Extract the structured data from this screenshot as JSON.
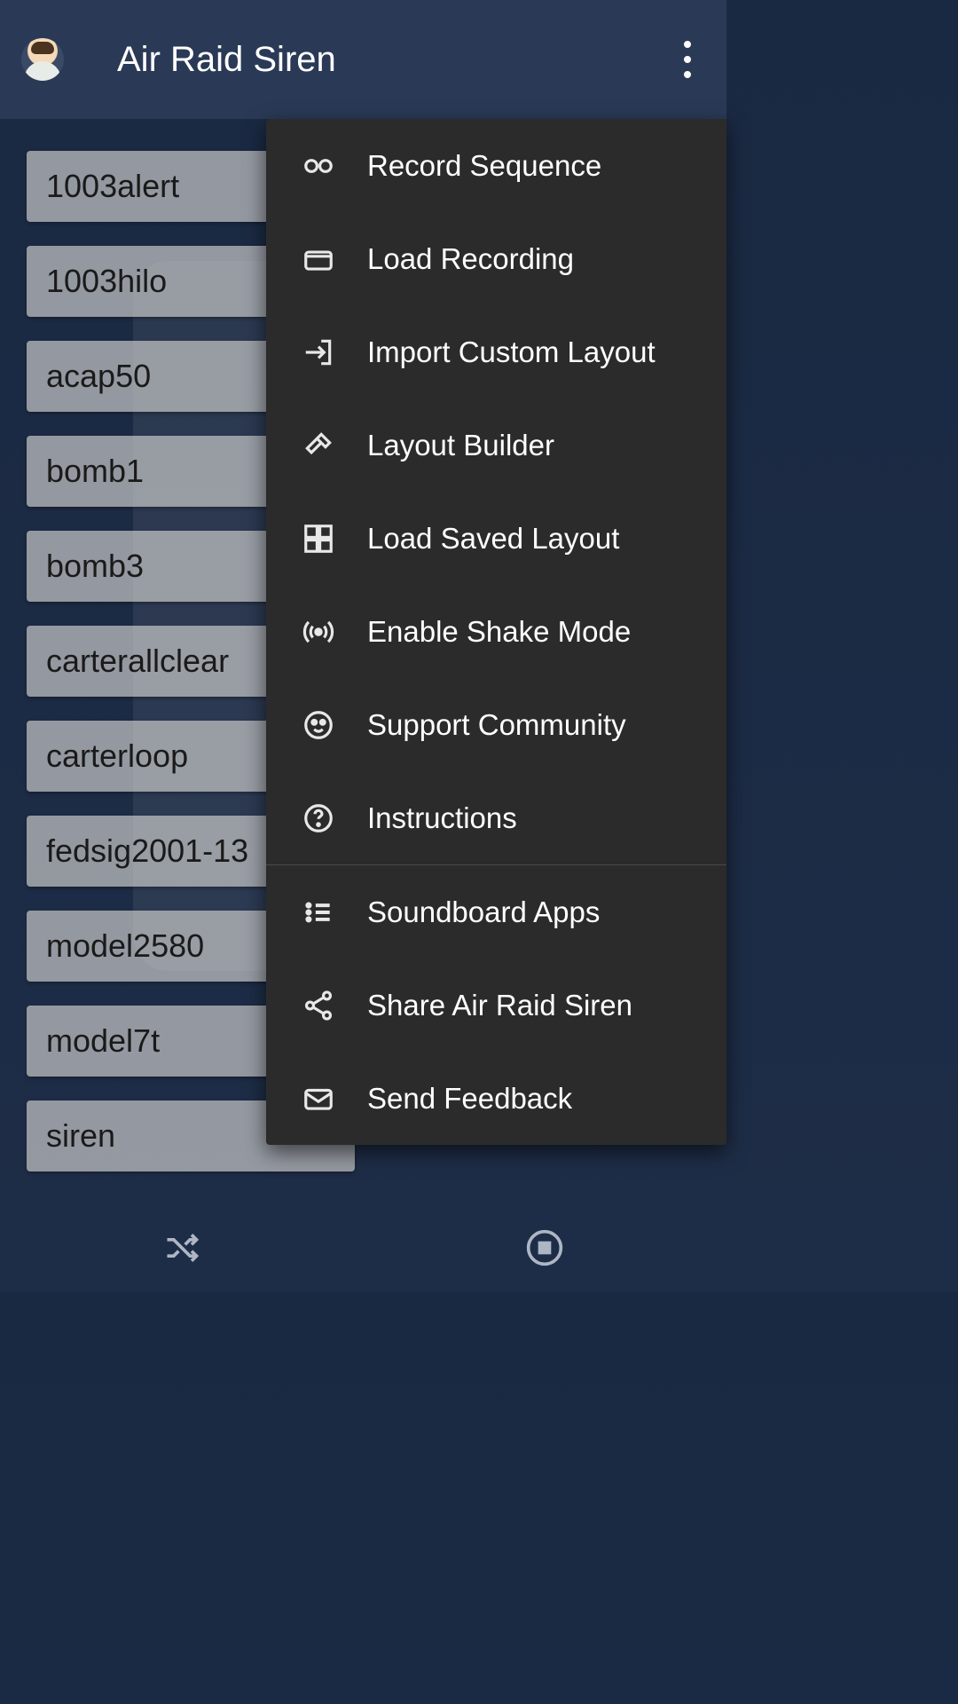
{
  "header": {
    "title": "Air Raid Siren"
  },
  "sounds": [
    "1003alert",
    "1003hilo",
    "acap50",
    "bomb1",
    "bomb3",
    "carterallclear",
    "carterloop",
    "fedsig2001-13",
    "model2580",
    "model7t",
    "siren"
  ],
  "menu": {
    "section1": [
      {
        "icon": "record",
        "label": "Record Sequence"
      },
      {
        "icon": "folder",
        "label": "Load Recording"
      },
      {
        "icon": "import",
        "label": "Import Custom Layout"
      },
      {
        "icon": "hammer",
        "label": "Layout Builder"
      },
      {
        "icon": "grid",
        "label": "Load Saved Layout"
      },
      {
        "icon": "shake",
        "label": "Enable Shake Mode"
      },
      {
        "icon": "community",
        "label": "Support Community"
      },
      {
        "icon": "help",
        "label": "Instructions"
      }
    ],
    "section2": [
      {
        "icon": "list",
        "label": "Soundboard Apps"
      },
      {
        "icon": "share",
        "label": "Share Air Raid Siren"
      },
      {
        "icon": "mail",
        "label": "Send Feedback"
      }
    ]
  }
}
